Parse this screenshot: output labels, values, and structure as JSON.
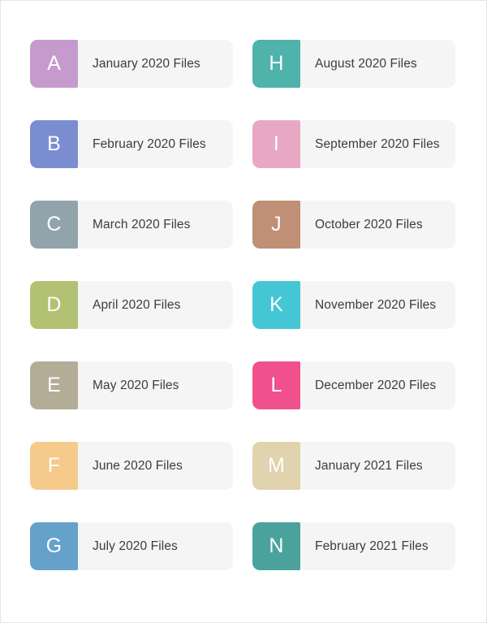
{
  "page": {
    "background_color": "#ffffff",
    "border_color": "#e6e6e6",
    "pill_background_color": "#f5f5f5",
    "label_text_color": "#3c3c3c",
    "badge_text_color": "#ffffff"
  },
  "folders": [
    {
      "initial": "A",
      "label": "January 2020 Files",
      "color": "#c59bcd"
    },
    {
      "initial": "H",
      "label": "August 2020 Files",
      "color": "#4fb3ac"
    },
    {
      "initial": "B",
      "label": "February 2020 Files",
      "color": "#7b8dd1"
    },
    {
      "initial": "I",
      "label": "September 2020 Files",
      "color": "#e8a8c4"
    },
    {
      "initial": "C",
      "label": "March 2020 Files",
      "color": "#92a4ab"
    },
    {
      "initial": "J",
      "label": "October 2020 Files",
      "color": "#c08f75"
    },
    {
      "initial": "D",
      "label": "April 2020 Files",
      "color": "#b3c172"
    },
    {
      "initial": "K",
      "label": "November 2020 Files",
      "color": "#45c6d4"
    },
    {
      "initial": "E",
      "label": "May 2020 Files",
      "color": "#b3ac97"
    },
    {
      "initial": "L",
      "label": "December 2020 Files",
      "color": "#f0508c"
    },
    {
      "initial": "F",
      "label": "June 2020 Files",
      "color": "#f6ca8b"
    },
    {
      "initial": "M",
      "label": "January 2021 Files",
      "color": "#e0d3ad"
    },
    {
      "initial": "G",
      "label": "July 2020 Files",
      "color": "#64a2ca"
    },
    {
      "initial": "N",
      "label": "February 2021 Files",
      "color": "#4ba29d"
    }
  ]
}
